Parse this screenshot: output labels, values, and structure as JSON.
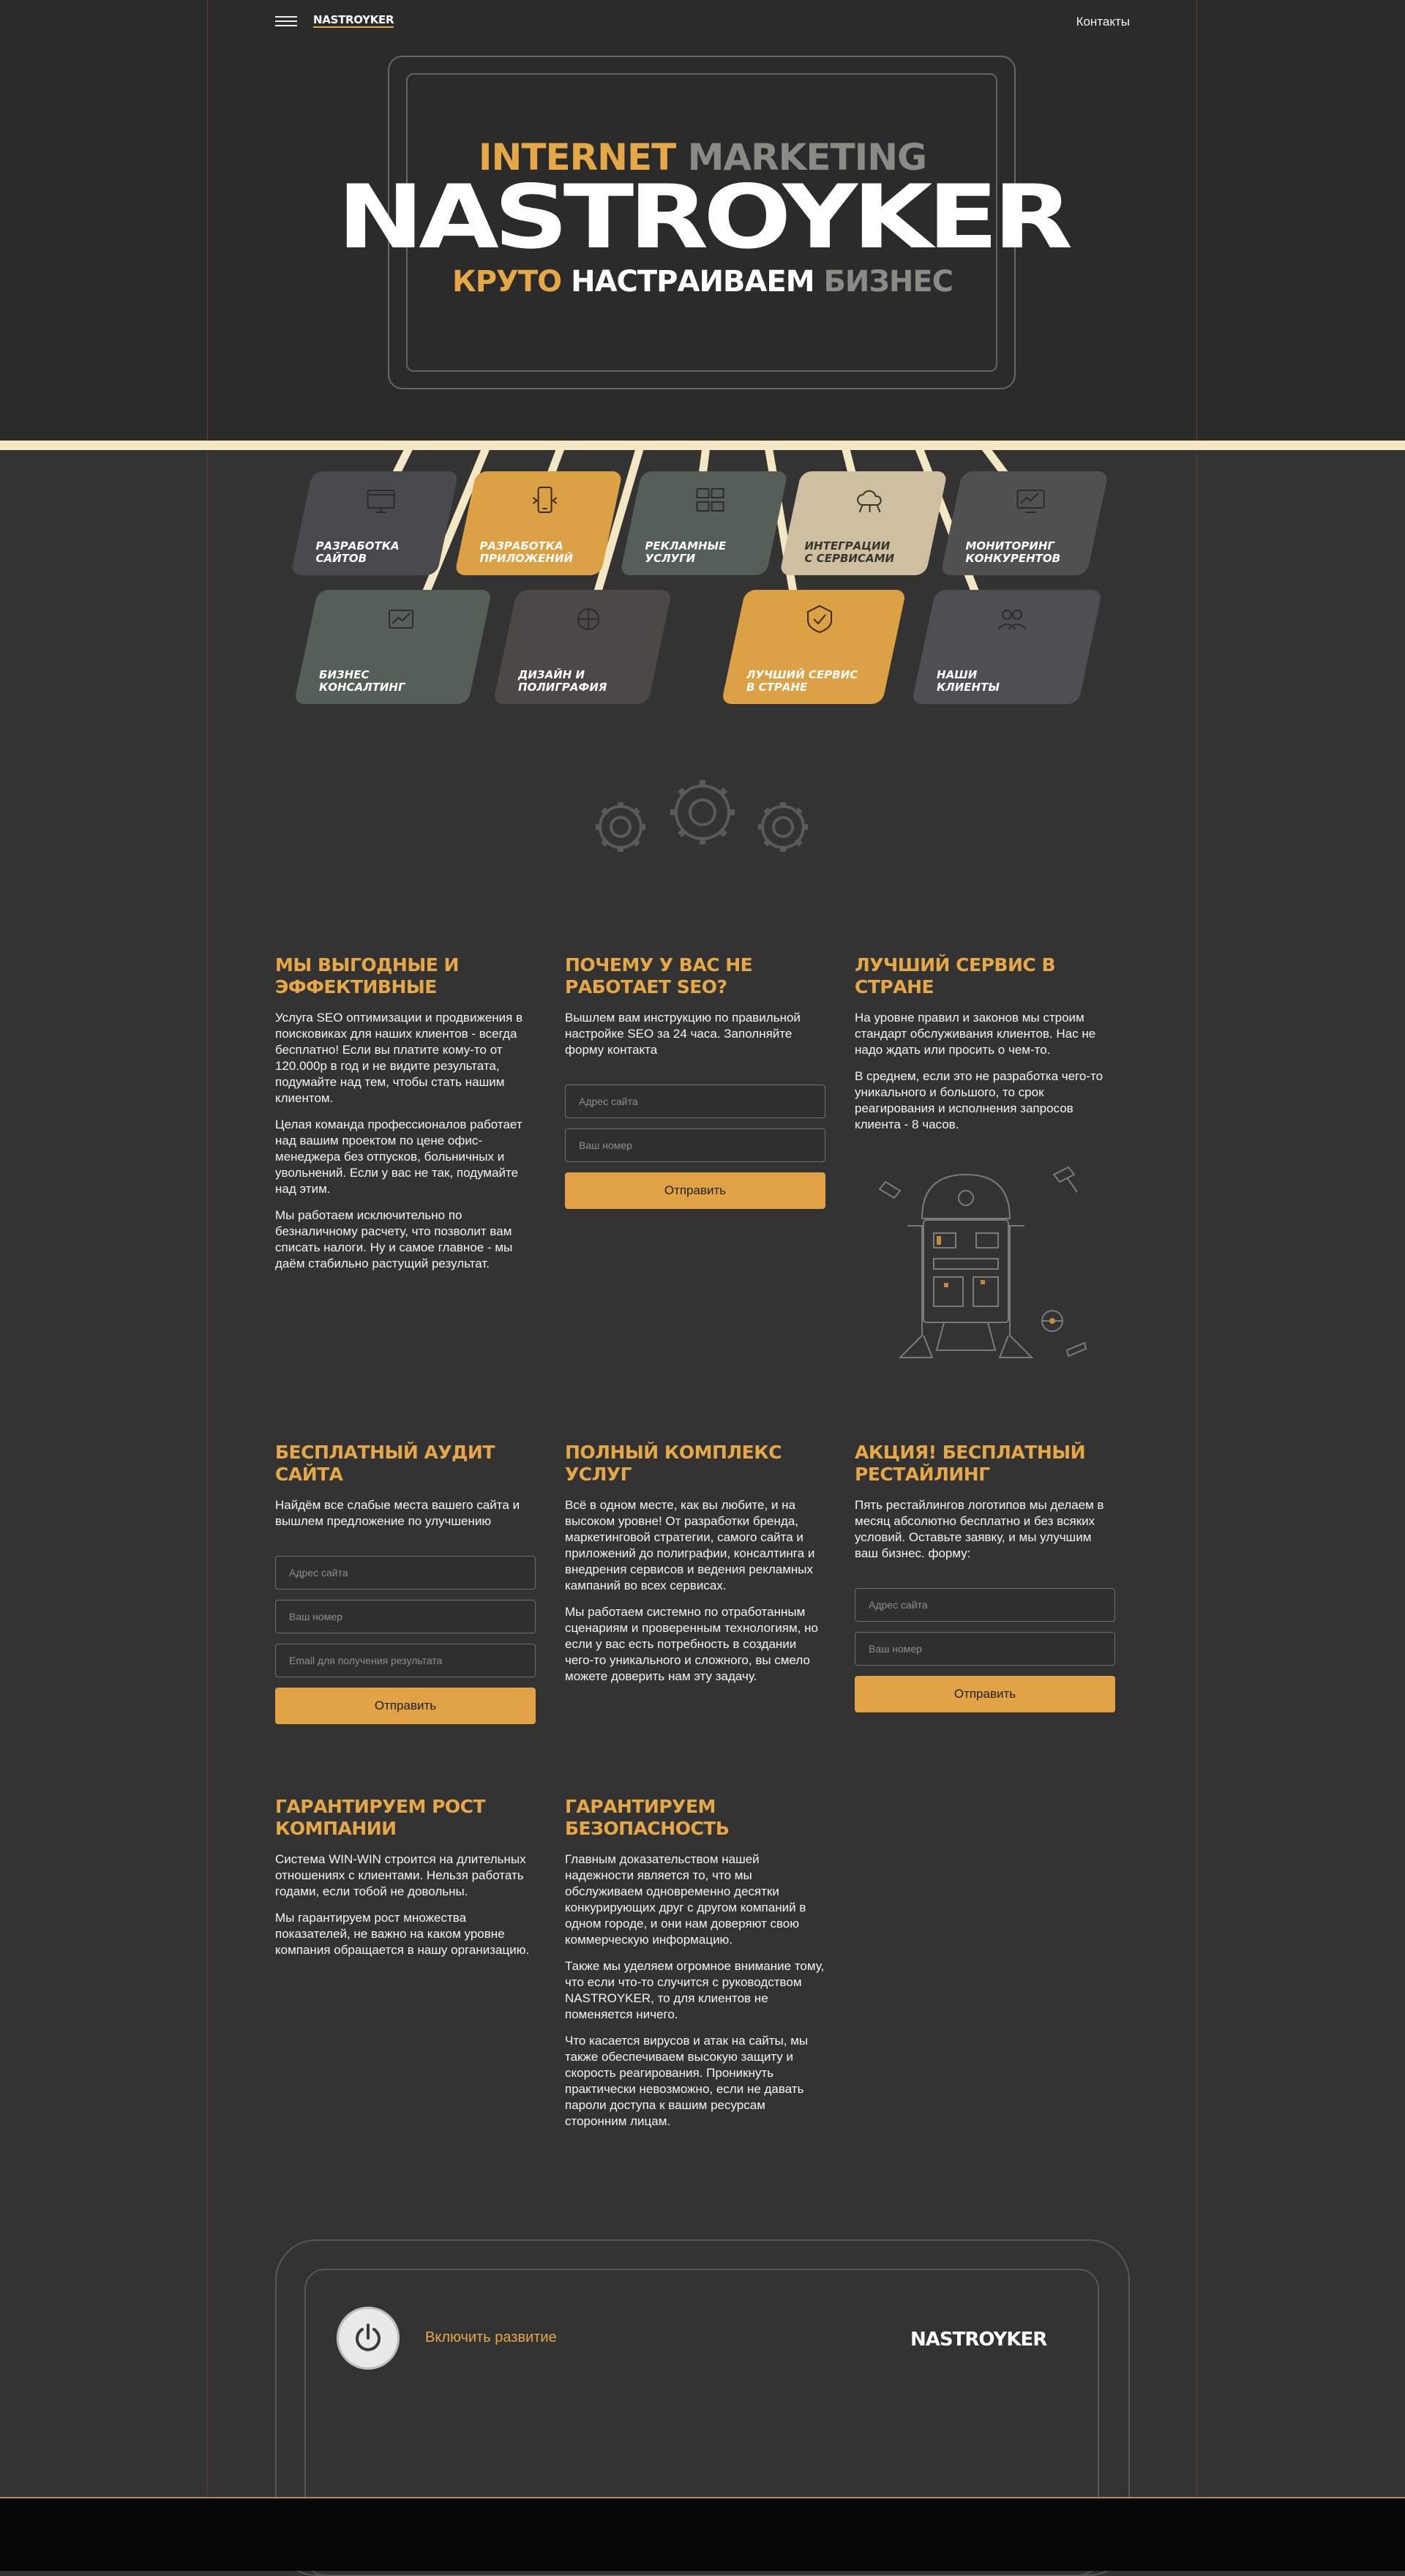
{
  "header": {
    "logo": "NASTROYKER",
    "contacts": "Контакты"
  },
  "hero": {
    "line1_a": "INTERNET",
    "line1_b": "MARKETING",
    "title": "NASTROYKER",
    "line3_a": "КРУТО",
    "line3_b": "НАСТРАИВАЕМ",
    "line3_c": "БИЗНЕС"
  },
  "services": [
    {
      "label_1": "РАЗРАБОТКА",
      "label_2": "САЙТОВ",
      "icon": "web-dev-icon"
    },
    {
      "label_1": "РАЗРАБОТКА",
      "label_2": "ПРИЛОЖЕНИЙ",
      "icon": "app-dev-icon"
    },
    {
      "label_1": "РЕКЛАМНЫЕ",
      "label_2": "УСЛУГИ",
      "icon": "ads-icon"
    },
    {
      "label_1": "ИНТЕГРАЦИИ",
      "label_2": "С СЕРВИСАМИ",
      "icon": "cloud-icon"
    },
    {
      "label_1": "МОНИТОРИНГ",
      "label_2": "КОНКУРЕНТОВ",
      "icon": "monitoring-icon"
    },
    {
      "label_1": "БИЗНЕС",
      "label_2": "КОНСАЛТИНГ",
      "icon": "consulting-icon"
    },
    {
      "label_1": "ДИЗАЙН И",
      "label_2": "ПОЛИГРАФИЯ",
      "icon": "design-icon"
    },
    {
      "label_1": "ЛУЧШИЙ СЕРВИС",
      "label_2": "В СТРАНЕ",
      "icon": "service-icon"
    },
    {
      "label_1": "НАШИ",
      "label_2": "КЛИЕНТЫ",
      "icon": "clients-icon"
    }
  ],
  "blocks": {
    "b1": {
      "title": "МЫ ВЫГОДНЫЕ И ЭФФЕКТИВНЫЕ",
      "p1": "Услуга SEO оптимизации и продвижения в поисковиках для наших клиентов - всегда бесплатно! Если вы платите кому-то от 120.000р в год и не видите результата, подумайте над тем, чтобы стать нашим клиентом.",
      "p2": "Целая команда профессионалов работает над вашим проектом по цене офис-менеджера без отпусков, больничных и увольнений. Если у вас не так, подумайте над этим.",
      "p3": "Мы работаем исключительно по безналичному расчету, что позволит вам списать налоги. Ну и самое главное - мы даём стабильно растущий результат."
    },
    "b2": {
      "title": "ПОЧЕМУ У ВАС НЕ РАБОТАЕТ SEO?",
      "p1": "Вышлем вам инструкцию по правильной настройке SEO за 24 часа. Заполняйте форму контакта",
      "site_ph": "Адрес сайта",
      "phone_ph": "Ваш номер",
      "btn": "Отправить"
    },
    "b3": {
      "title": "ЛУЧШИЙ СЕРВИС В СТРАНЕ",
      "p1": "На уровне правил и законов мы строим стандарт обслуживания клиентов. Нас не надо ждать или просить о чем-то.",
      "p2": "В среднем, если это не разработка чего-то уникального и большого, то срок реагирования и исполнения запросов клиента - 8 часов."
    },
    "b4": {
      "title": "БЕСПЛАТНЫЙ АУДИТ САЙТА",
      "p1": "Найдём все слабые места вашего сайта и вышлем предложение по улучшению",
      "site_ph": "Адрес сайта",
      "phone_ph": "Ваш номер",
      "email_ph": "Email для получения результата",
      "btn": "Отправить"
    },
    "b5": {
      "title": "ПОЛНЫЙ КОМПЛЕКС УСЛУГ",
      "p1": "Всё в одном месте, как вы любите, и на высоком уровне! От разработки бренда, маркетинговой стратегии, самого сайта и приложений до полиграфии, консалтинга и внедрения сервисов и ведения рекламных кампаний во всех сервисах.",
      "p2": "Мы работаем системно по отработанным сценариям и проверенным технологиям, но если у вас есть потребность в создании чего-то уникального и сложного, вы смело можете доверить нам эту задачу."
    },
    "b6": {
      "title": "АКЦИЯ! БЕСПЛАТНЫЙ РЕСТАЙЛИНГ",
      "p1": "Пять рестайлингов логотипов мы делаем в месяц абсолютно бесплатно и без всяких условий. Оставьте заявку, и мы улучшим ваш бизнес. форму:",
      "site_ph": "Адрес сайта",
      "phone_ph": "Ваш номер",
      "btn": "Отправить"
    },
    "b7": {
      "title": "ГАРАНТИРУЕМ РОСТ КОМПАНИИ",
      "p1": "Система WIN-WIN строится на длительных отношениях с клиентами. Нельзя работать годами, если тобой не довольны.",
      "p2": "Мы гарантируем рост множества показателей, не важно на каком уровне компания обращается в нашу организацию."
    },
    "b8": {
      "title": "ГАРАНТИРУЕМ БЕЗОПАСНОСТЬ",
      "p1": "Главным доказательством нашей надежности является то, что мы обслуживаем одновременно десятки конкурирующих друг с другом компаний в одном городе, и они нам доверяют свою коммерческую информацию.",
      "p2": "Также мы уделяем огромное внимание тому, что если что-то случится с руководством NASTROYKER, то для клиентов не поменяется ничего.",
      "p3": "Что касается вирусов и атак на сайты, мы также обеспечиваем высокую защиту и скорость реагирования. Проникнуть практически невозможно, если не давать пароли доступа к вашим ресурсам сторонним лицам."
    }
  },
  "footer": {
    "enable": "Включить развитие",
    "logo": "NASTROYKER"
  },
  "colors": {
    "accent": "#e6a846",
    "background": "#333333",
    "hero_bg": "#2b2b2b",
    "bar": "#f3e7c4"
  }
}
